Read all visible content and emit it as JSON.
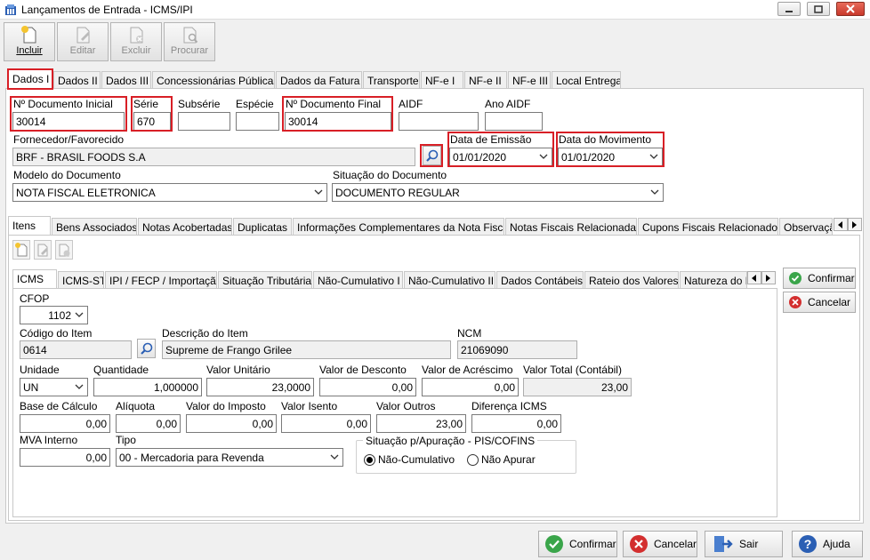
{
  "window": {
    "title": "Lançamentos de Entrada - ICMS/IPI"
  },
  "toolbar": {
    "incluir": "Incluir",
    "editar": "Editar",
    "excluir": "Excluir",
    "procurar": "Procurar"
  },
  "main_tabs": [
    "Dados I",
    "Dados II",
    "Dados III",
    "Concessionárias Públicas",
    "Dados da Fatura",
    "Transporte",
    "NF-e I",
    "NF-e II",
    "NF-e III",
    "Local Entrega"
  ],
  "header": {
    "num_doc_inicial_label": "Nº Documento Inicial",
    "num_doc_inicial": "30014",
    "serie_label": "Série",
    "serie": "670",
    "subserie_label": "Subsérie",
    "subserie": "",
    "especie_label": "Espécie",
    "especie": "",
    "num_doc_final_label": "Nº Documento Final",
    "num_doc_final": "30014",
    "aidf_label": "AIDF",
    "aidf": "",
    "ano_aidf_label": "Ano AIDF",
    "ano_aidf": "",
    "fornecedor_label": "Fornecedor/Favorecido",
    "fornecedor": "BRF - BRASIL FOODS S.A",
    "data_emissao_label": "Data de Emissão",
    "data_emissao": "01/01/2020",
    "data_movimento_label": "Data do Movimento",
    "data_movimento": "01/01/2020",
    "modelo_label": "Modelo do Documento",
    "modelo": "NOTA FISCAL ELETRONICA",
    "situacao_label": "Situação do Documento",
    "situacao": "DOCUMENTO REGULAR"
  },
  "sub_tabs": [
    "Itens",
    "Bens Associados",
    "Notas Acobertadas",
    "Duplicatas",
    "Informações Complementares da Nota Fiscal",
    "Notas Fiscais Relacionadas",
    "Cupons Fiscais Relacionados",
    "Observaçã"
  ],
  "item_tabs": [
    "ICMS",
    "ICMS-ST",
    "IPI / FECP / Importação",
    "Situação Tributária",
    "Não-Cumulativo I",
    "Não-Cumulativo II",
    "Dados Contábeis",
    "Rateio dos Valores",
    "Natureza do F"
  ],
  "item": {
    "cfop_label": "CFOP",
    "cfop": "1102",
    "codigo_label": "Código do Item",
    "codigo": "0614",
    "descricao_label": "Descrição do Item",
    "descricao": "Supreme de Frango Grilee",
    "ncm_label": "NCM",
    "ncm": "21069090",
    "unidade_label": "Unidade",
    "unidade": "UN",
    "quantidade_label": "Quantidade",
    "quantidade": "1,000000",
    "valor_unitario_label": "Valor Unitário",
    "valor_unitario": "23,0000",
    "valor_desconto_label": "Valor de Desconto",
    "valor_desconto": "0,00",
    "valor_acrescimo_label": "Valor de Acréscimo",
    "valor_acrescimo": "0,00",
    "valor_total_label": "Valor Total (Contábil)",
    "valor_total": "23,00",
    "base_calculo_label": "Base de Cálculo",
    "base_calculo": "0,00",
    "aliquota_label": "Alíquota",
    "aliquota": "0,00",
    "valor_imposto_label": "Valor do Imposto",
    "valor_imposto": "0,00",
    "valor_isento_label": "Valor Isento",
    "valor_isento": "0,00",
    "valor_outros_label": "Valor Outros",
    "valor_outros": "23,00",
    "diferenca_icms_label": "Diferença ICMS",
    "diferenca_icms": "0,00",
    "mva_label": "MVA Interno",
    "mva": "0,00",
    "tipo_label": "Tipo",
    "tipo": "00 - Mercadoria para Revenda",
    "apuracao_label": "Situação p/Apuração - PIS/COFINS",
    "nao_cumulativo": "Não-Cumulativo",
    "nao_apurar": "Não Apurar"
  },
  "side_buttons": {
    "confirmar": "Confirmar",
    "cancelar": "Cancelar"
  },
  "bottom_buttons": {
    "confirmar": "Confirmar",
    "cancelar": "Cancelar",
    "sair": "Sair",
    "ajuda": "Ajuda"
  },
  "colors": {
    "highlight": "#d81f26",
    "confirm": "#3aa54a",
    "cancel": "#d32f2f",
    "help": "#2b5fb4"
  }
}
